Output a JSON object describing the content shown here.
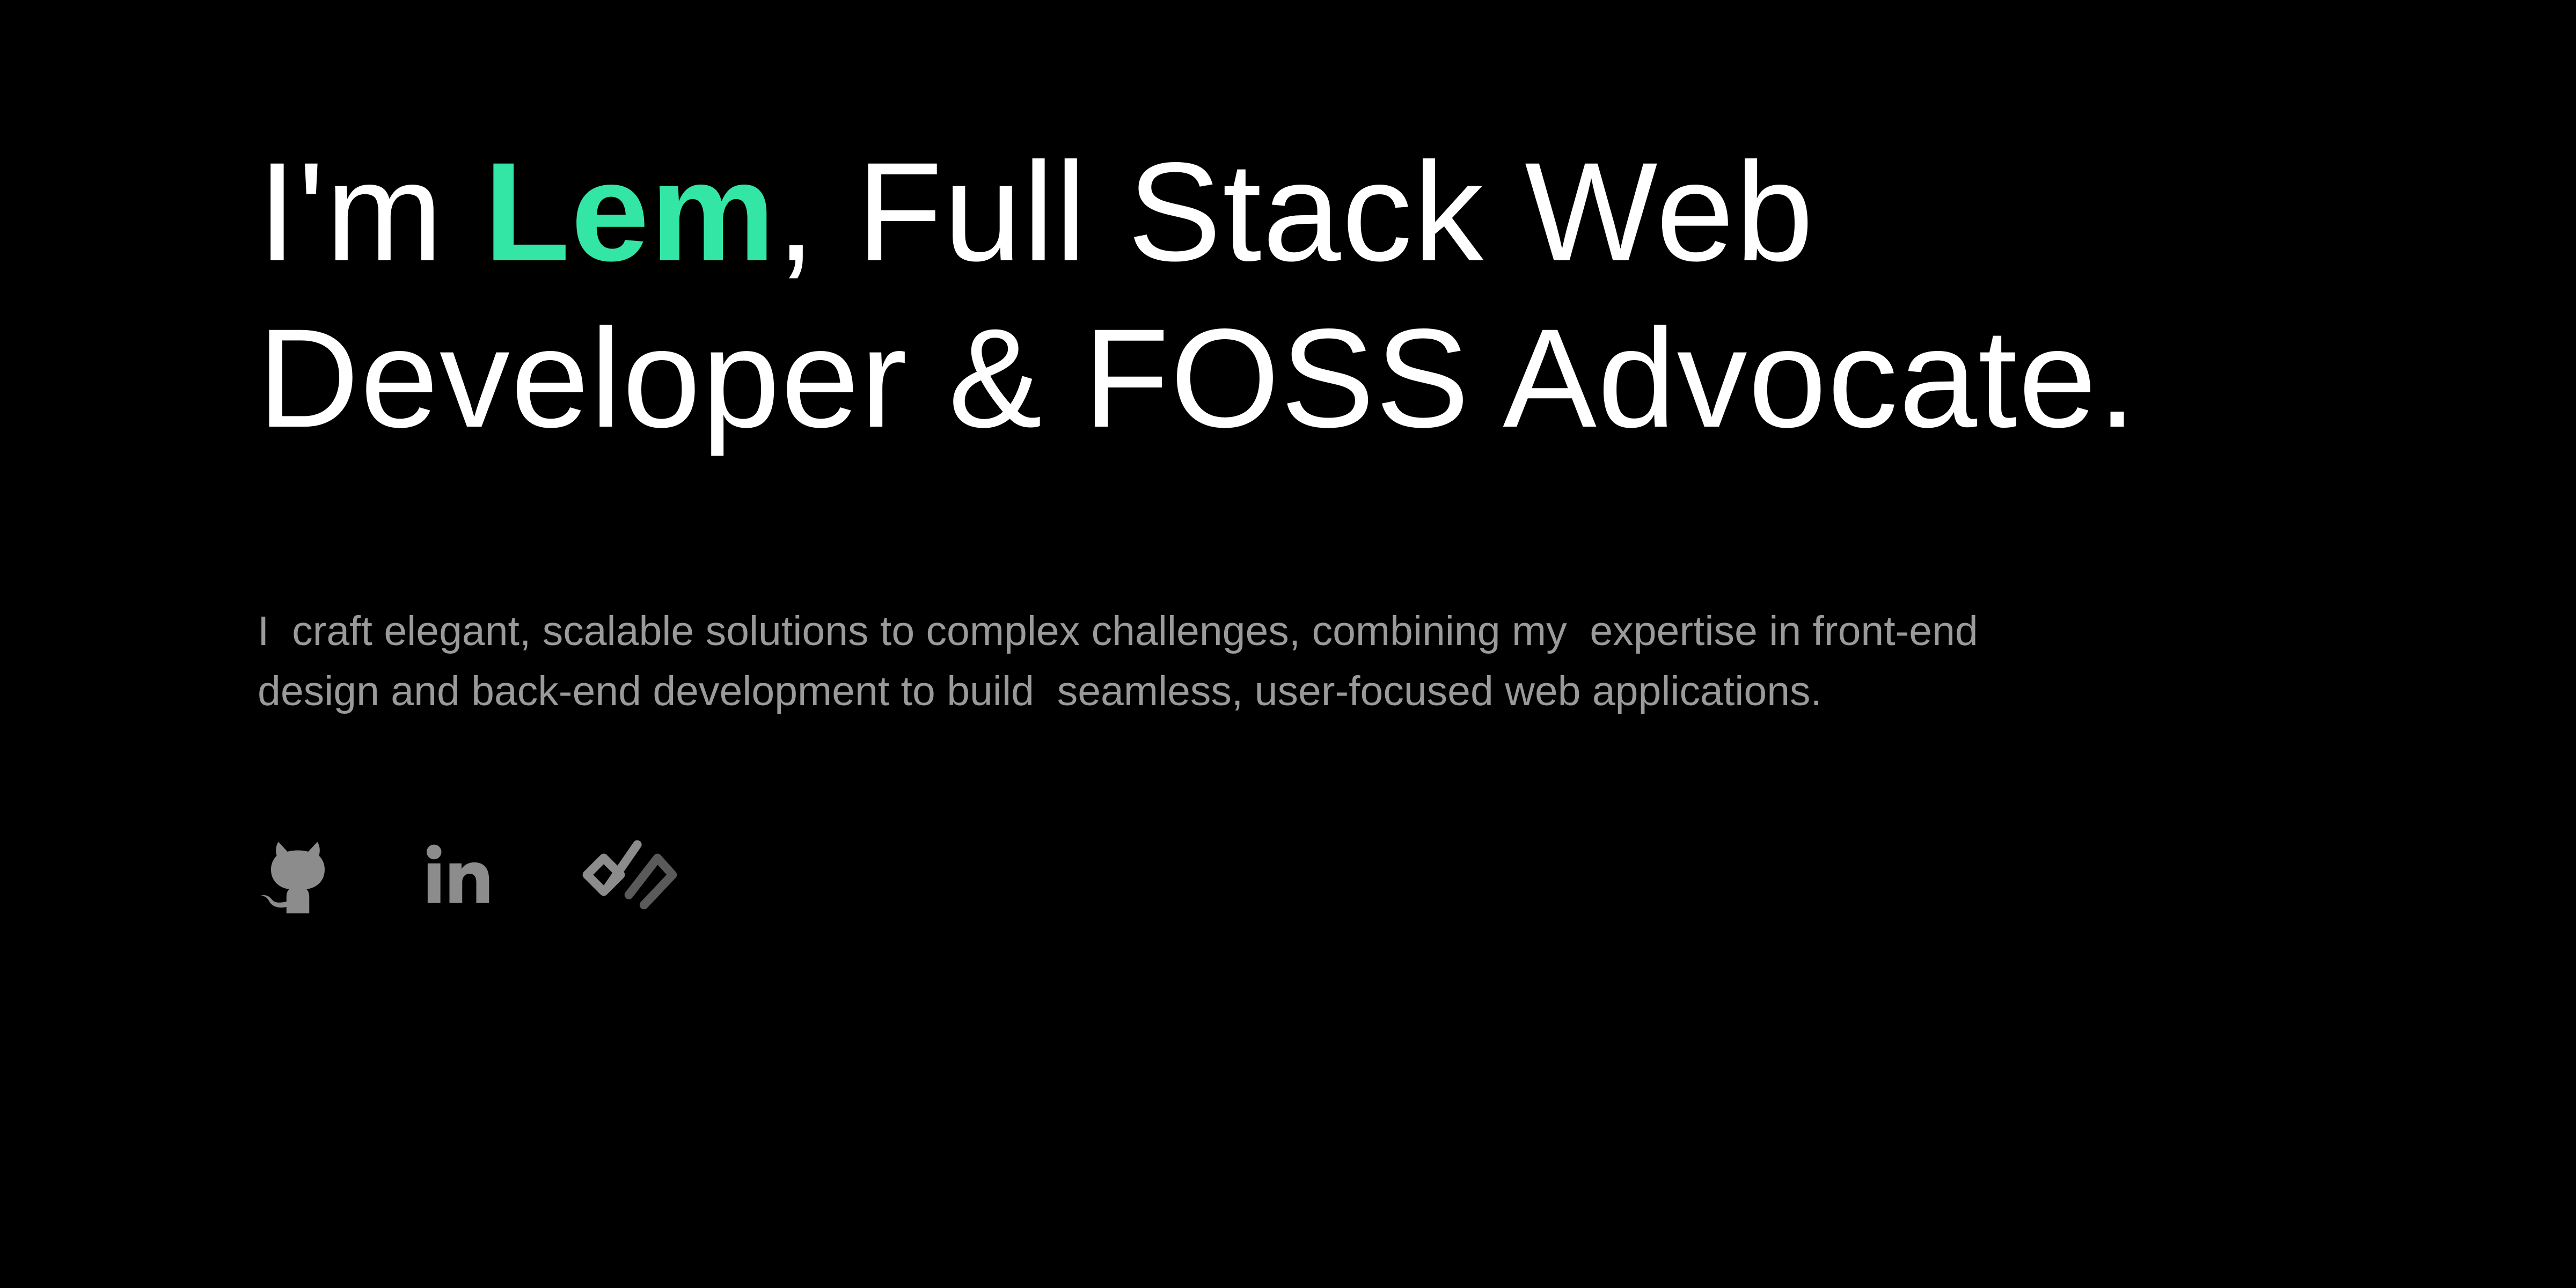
{
  "hero": {
    "headline_prefix": "I'm ",
    "headline_name": "Lem",
    "headline_suffix_line1": ", Full Stack Web",
    "headline_line2": "Developer & FOSS Advocate.",
    "intro_line1": "I  craft elegant, scalable solutions to complex challenges, combining my  expertise in front-end",
    "intro_line2": "design and back-end development to build  seamless, user-focused web applications."
  },
  "socials": [
    {
      "icon": "github-icon"
    },
    {
      "icon": "linkedin-icon"
    },
    {
      "icon": "devto-icon"
    }
  ],
  "colors": {
    "background": "#000000",
    "headline": "#ffffff",
    "accent": "#34e6a6",
    "body_text": "#9a9a9a",
    "icon": "#8c8c8c"
  }
}
